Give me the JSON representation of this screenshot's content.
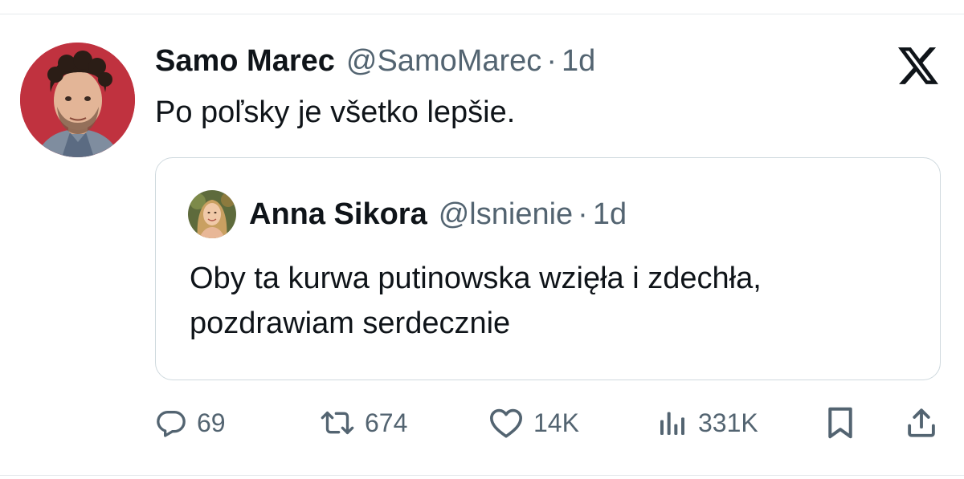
{
  "tweet": {
    "author": {
      "name": "Samo Marec",
      "handle": "@SamoMarec",
      "separator": "·",
      "time": "1d"
    },
    "text": "Po poľsky je všetko lepšie.",
    "quoted": {
      "author": {
        "name": "Anna Sikora",
        "handle": "@lsnienie",
        "separator": "·",
        "time": "1d"
      },
      "text": "Oby ta kurwa putinowska wzięła i zdechła, pozdrawiam serdecznie"
    },
    "actions": {
      "replies": "69",
      "reposts": "674",
      "likes": "14K",
      "views": "331K"
    }
  },
  "colors": {
    "text_primary": "#0f1419",
    "text_secondary": "#536471",
    "border": "#cfd9de"
  },
  "icons": {
    "brand": "x-logo-icon",
    "reply": "speech-bubble-icon",
    "repost": "repost-arrows-icon",
    "like": "heart-icon",
    "views": "bar-chart-icon",
    "bookmark": "bookmark-icon",
    "share": "share-upload-icon"
  }
}
